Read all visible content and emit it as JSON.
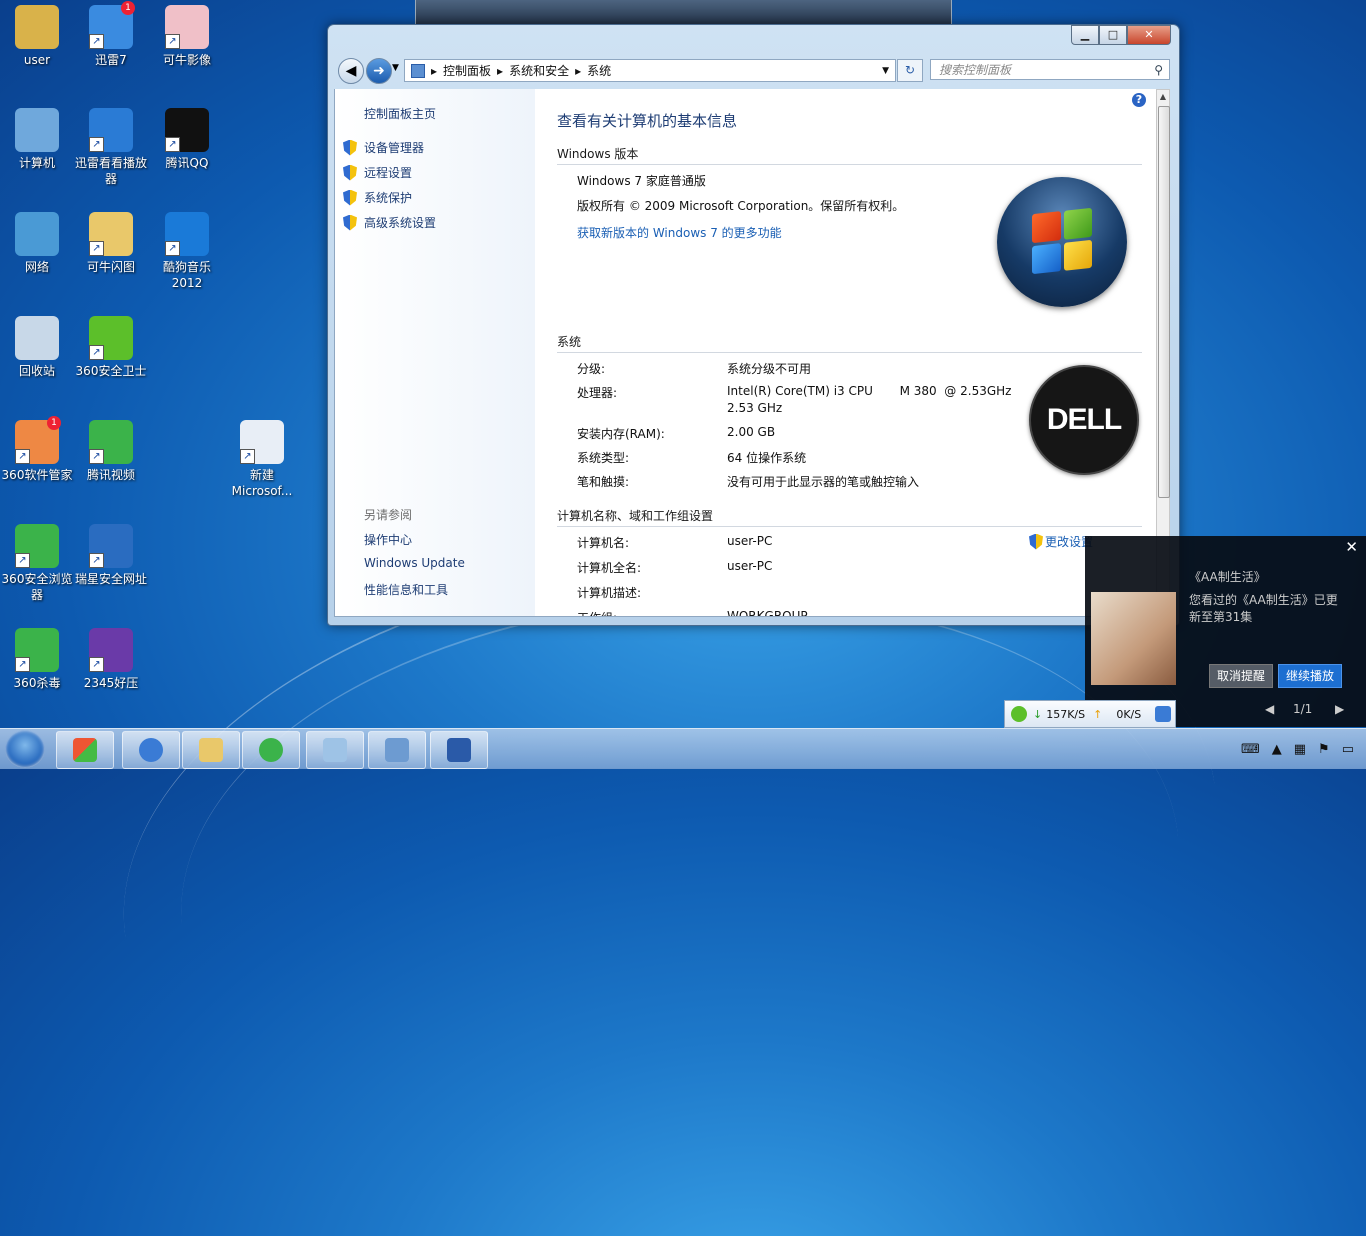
{
  "desktop": {
    "icons": [
      {
        "label": "user"
      },
      {
        "label": "迅雷7",
        "badge": "1"
      },
      {
        "label": "可牛影像"
      },
      {
        "label": "计算机"
      },
      {
        "label": "迅雷看看播放器"
      },
      {
        "label": "腾讯QQ"
      },
      {
        "label": "网络"
      },
      {
        "label": "可牛闪图"
      },
      {
        "label": "酷狗音乐2012"
      },
      {
        "label": "回收站"
      },
      {
        "label": "360安全卫士"
      },
      {
        "label": "360软件管家",
        "badge": "1"
      },
      {
        "label": "腾讯视频"
      },
      {
        "label": "新建 Microsof..."
      },
      {
        "label": "360安全浏览器"
      },
      {
        "label": "瑞星安全网址"
      },
      {
        "label": "360杀毒"
      },
      {
        "label": "2345好压"
      }
    ]
  },
  "window": {
    "buttons": {
      "minimize": "▁",
      "maximize": "□",
      "close": "✕"
    },
    "breadcrumb": [
      "控制面板",
      "系统和安全",
      "系统"
    ],
    "search_placeholder": "搜索控制面板",
    "left": {
      "home": "控制面板主页",
      "tasks": [
        "设备管理器",
        "远程设置",
        "系统保护",
        "高级系统设置"
      ],
      "see_also_title": "另请参阅",
      "see_also": [
        "操作中心",
        "Windows Update",
        "性能信息和工具"
      ]
    },
    "content": {
      "title": "查看有关计算机的基本信息",
      "edition_heading": "Windows 版本",
      "edition": "Windows 7 家庭普通版",
      "copyright": "版权所有 © 2009 Microsoft Corporation。保留所有权利。",
      "upgrade_link": "获取新版本的 Windows 7 的更多功能",
      "system_heading": "系统",
      "system_rows": [
        {
          "label": "分级:",
          "value": "系统分级不可用",
          "link": true
        },
        {
          "label": "处理器:",
          "value": "Intel(R) Core(TM) i3 CPU       M 380  @ 2.53GHz",
          "value2": "2.53 GHz"
        },
        {
          "label": "安装内存(RAM):",
          "value": "2.00 GB"
        },
        {
          "label": "系统类型:",
          "value": "64 位操作系统"
        },
        {
          "label": "笔和触摸:",
          "value": "没有可用于此显示器的笔或触控输入"
        }
      ],
      "oem_logo": "DELL",
      "computer_heading": "计算机名称、域和工作组设置",
      "change_settings": "更改设置",
      "computer_rows": [
        {
          "label": "计算机名:",
          "value": "user-PC"
        },
        {
          "label": "计算机全名:",
          "value": "user-PC"
        },
        {
          "label": "计算机描述:",
          "value": ""
        },
        {
          "label": "工作组:",
          "value": "WORKGROUP"
        }
      ]
    }
  },
  "popup": {
    "title": "《AA制生活》",
    "message": "您看过的《AA制生活》已更新至第31集",
    "cancel": "取消提醒",
    "play": "继续播放",
    "pager": "1/1"
  },
  "speedbar": {
    "down": "157K/S",
    "up": "0K/S"
  }
}
